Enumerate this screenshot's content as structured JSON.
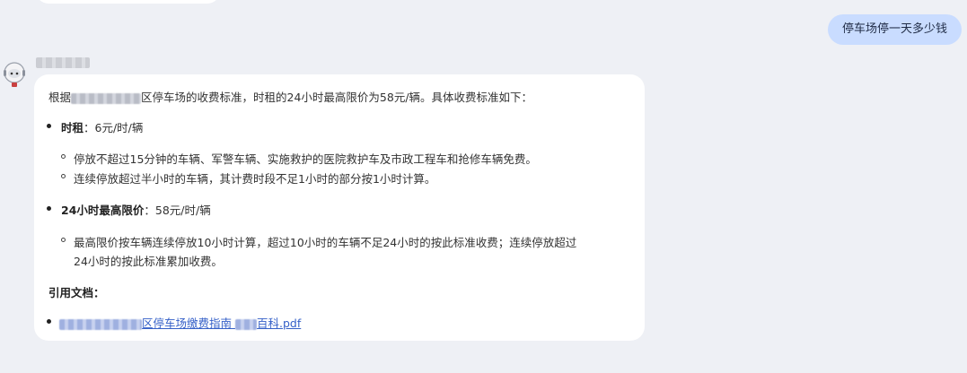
{
  "user_message": "停车场停一天多少钱",
  "answer": {
    "intro_prefix": "根据",
    "intro_suffix": "区停车场的收费标准，时租的24小时最高限价为58元/辆。具体收费标准如下：",
    "sections": [
      {
        "title": "时租",
        "value": "：6元/时/辆",
        "items": [
          "停放不超过15分钟的车辆、军警车辆、实施救护的医院救护车及市政工程车和抢修车辆免费。",
          "连续停放超过半小时的车辆，其计费时段不足1小时的部分按1小时计算。"
        ]
      },
      {
        "title": "24小时最高限价",
        "value": "：58元/时/辆",
        "items": [
          "最高限价按车辆连续停放10小时计算，超过10小时的车辆不足24小时的按此标准收费；连续停放超过",
          "24小时的按此标准累加收费。"
        ]
      }
    ],
    "references_title": "引用文档：",
    "reference_link_part1": "区停车场缴费指南",
    "reference_link_part2": "百科.pdf"
  }
}
